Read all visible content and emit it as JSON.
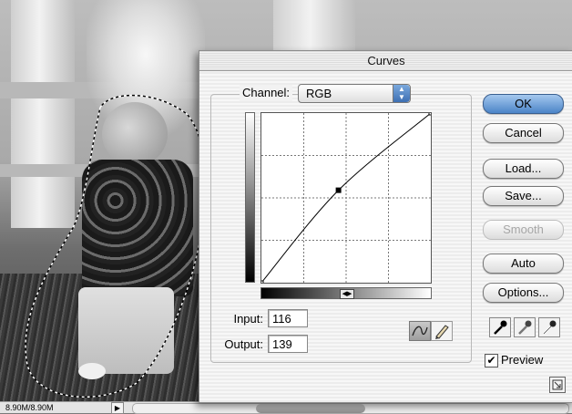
{
  "dialog": {
    "title": "Curves",
    "channel_label": "Channel:",
    "channel_value": "RGB",
    "input_label": "Input:",
    "input_value": "116",
    "output_label": "Output:",
    "output_value": "139",
    "preview_label": "Preview",
    "preview_checked": true,
    "icons": {
      "curve_tool": "curve-tool-icon",
      "pencil_tool": "pencil-icon",
      "black_point": "eyedropper-black-icon",
      "gray_point": "eyedropper-gray-icon",
      "white_point": "eyedropper-white-icon",
      "expand": "expand-icon"
    }
  },
  "buttons": {
    "ok": "OK",
    "cancel": "Cancel",
    "load": "Load...",
    "save": "Save...",
    "smooth": "Smooth",
    "auto": "Auto",
    "options": "Options..."
  },
  "curve": {
    "points": [
      [
        0,
        0
      ],
      [
        116,
        139
      ],
      [
        255,
        255
      ]
    ],
    "range": [
      0,
      255
    ],
    "grid_divisions": 4,
    "selected_point": [
      116,
      139
    ]
  },
  "status": {
    "doc_size": "8.90M/8.90M"
  }
}
